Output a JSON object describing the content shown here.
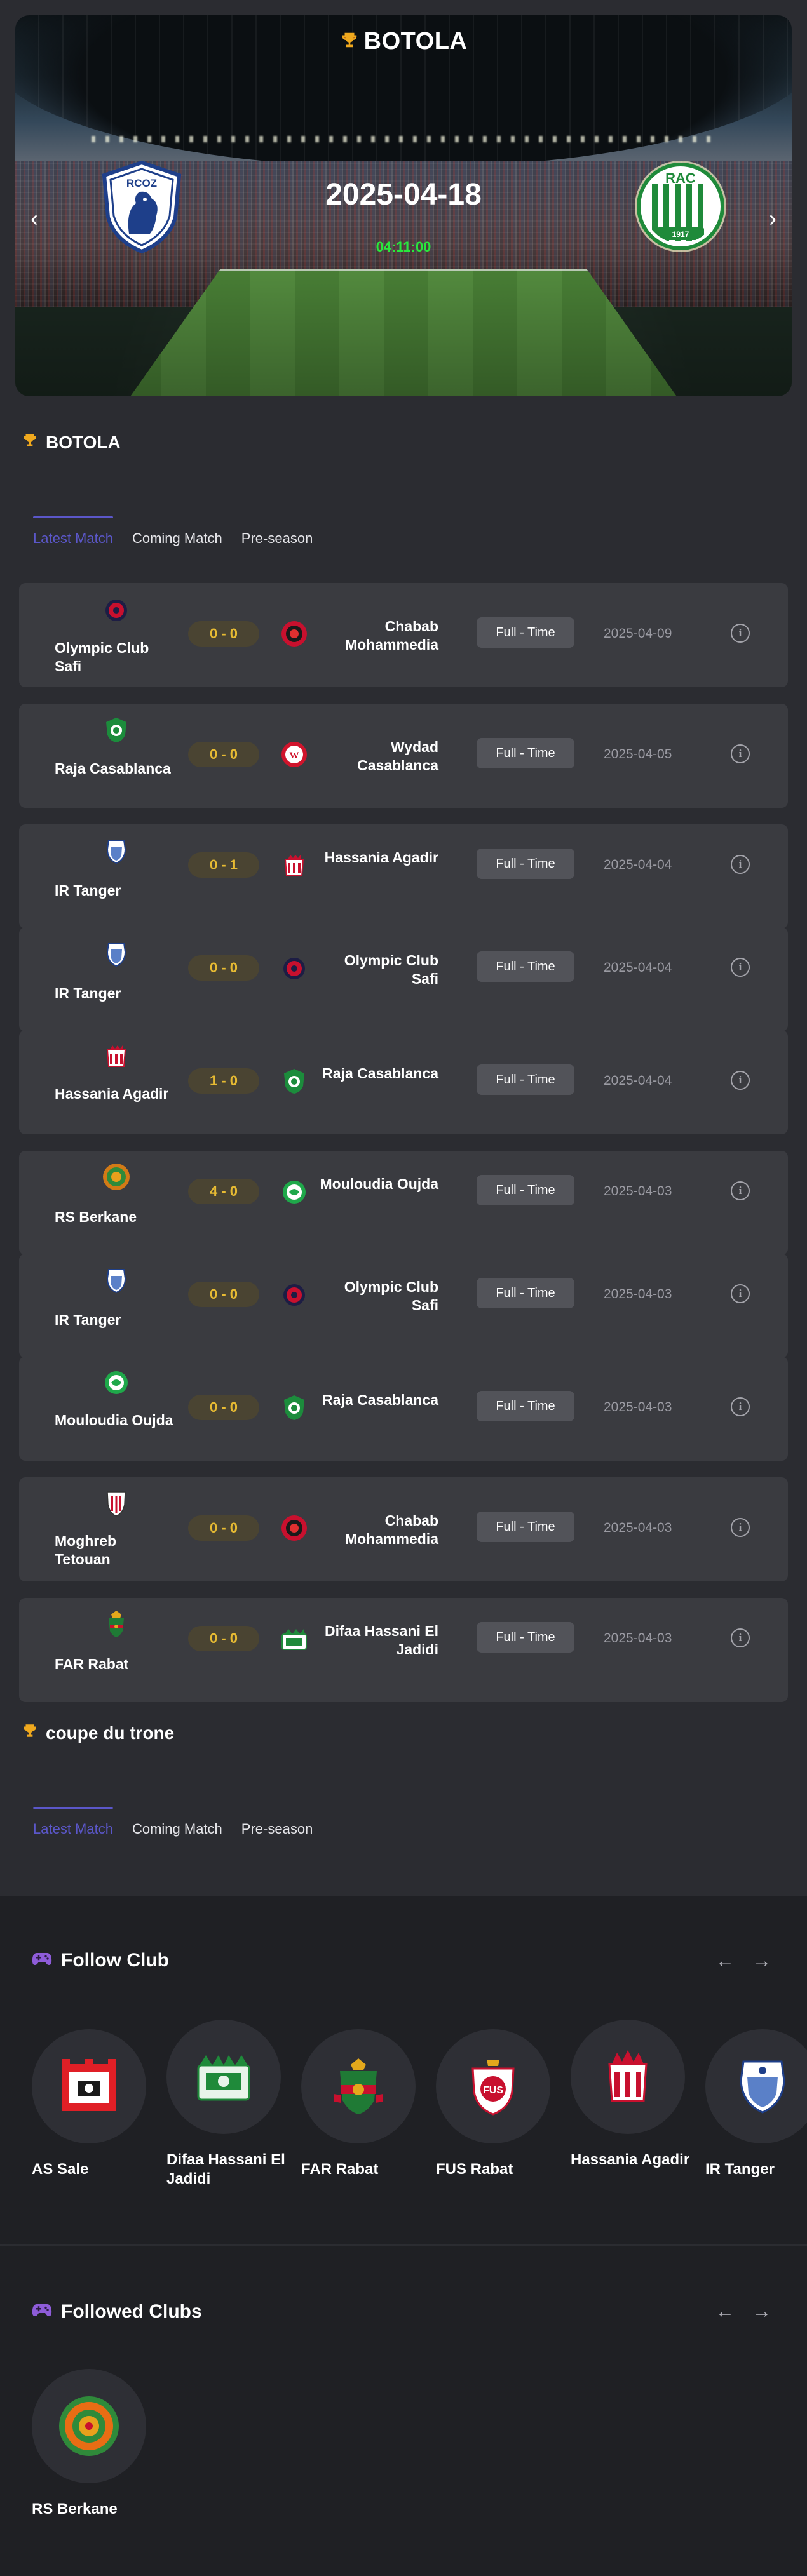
{
  "hero": {
    "league_title": "BOTOLA",
    "date": "2025-04-18",
    "countdown": "04:11:00",
    "home_logo_text": "RCOZ",
    "away_logo_text": "RAC",
    "away_logo_year": "1917"
  },
  "leagues": [
    {
      "title": "BOTOLA",
      "tabs": [
        "Latest Match",
        "Coming Match",
        "Pre-season"
      ],
      "matches": [
        {
          "home": "Olympic Club Safi",
          "score": "0 - 0",
          "away": "Chabab Mohammedia",
          "status": "Full - Time",
          "date": "2025-04-09"
        },
        {
          "home": "Raja Casablanca",
          "score": "0 - 0",
          "away": "Wydad Casablanca",
          "status": "Full - Time",
          "date": "2025-04-05"
        },
        {
          "home": "IR Tanger",
          "score": "0 - 1",
          "away": "Hassania Agadir",
          "status": "Full - Time",
          "date": "2025-04-04"
        },
        {
          "home": "IR Tanger",
          "score": "0 - 0",
          "away": "Olympic Club Safi",
          "status": "Full - Time",
          "date": "2025-04-04"
        },
        {
          "home": "Hassania Agadir",
          "score": "1 - 0",
          "away": "Raja Casablanca",
          "status": "Full - Time",
          "date": "2025-04-04"
        },
        {
          "home": "RS Berkane",
          "score": "4 - 0",
          "away": "Mouloudia Oujda",
          "status": "Full - Time",
          "date": "2025-04-03"
        },
        {
          "home": "IR Tanger",
          "score": "0 - 0",
          "away": "Olympic Club Safi",
          "status": "Full - Time",
          "date": "2025-04-03"
        },
        {
          "home": "Mouloudia Oujda",
          "score": "0 - 0",
          "away": "Raja Casablanca",
          "status": "Full - Time",
          "date": "2025-04-03"
        },
        {
          "home": "Moghreb Tetouan",
          "score": "0 - 0",
          "away": "Chabab Mohammedia",
          "status": "Full - Time",
          "date": "2025-04-03"
        },
        {
          "home": "FAR Rabat",
          "score": "0 - 0",
          "away": "Difaa Hassani El Jadidi",
          "status": "Full - Time",
          "date": "2025-04-03"
        }
      ]
    },
    {
      "title": "coupe du trone",
      "tabs": [
        "Latest Match",
        "Coming Match",
        "Pre-season"
      ]
    }
  ],
  "follow_club": {
    "title": "Follow Club",
    "clubs": [
      "AS Sale",
      "Difaa Hassani El Jadidi",
      "FAR Rabat",
      "FUS Rabat",
      "Hassania Agadir",
      "IR Tanger"
    ]
  },
  "followed_clubs": {
    "title": "Followed Clubs",
    "clubs": [
      "RS Berkane"
    ]
  },
  "icons": {
    "trophy": "trophy-icon",
    "gamepad": "gamepad-icon",
    "info": "info-icon",
    "arrow_left": "arrow-left-icon",
    "arrow_right": "arrow-right-icon"
  },
  "colors": {
    "background": "#2b2c31",
    "card": "#3a3b40",
    "accent": "#5b57c9",
    "score_text": "#e7bb33",
    "countdown": "#28e83c"
  }
}
